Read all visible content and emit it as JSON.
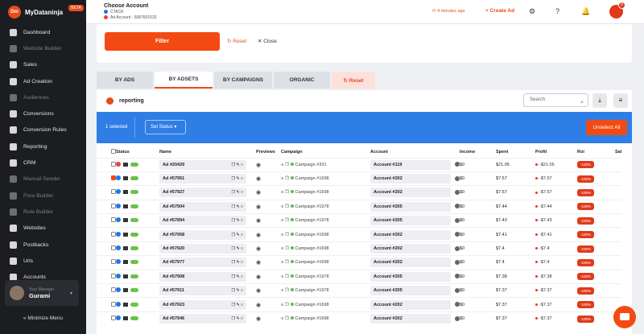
{
  "brand": {
    "logo_text": "Dm",
    "name": "MyDataninja",
    "badge": "BETA"
  },
  "sidebar": {
    "items": [
      {
        "label": "Dashboard",
        "dim": false,
        "icon": "dashboard-icon"
      },
      {
        "label": "Website Builder",
        "dim": true,
        "icon": "website-builder-icon"
      },
      {
        "label": "Sales",
        "dim": false,
        "icon": "sales-icon"
      },
      {
        "label": "Ad Creation",
        "dim": false,
        "icon": "ad-creation-icon"
      },
      {
        "label": "Audiences",
        "dim": true,
        "icon": "audiences-icon"
      },
      {
        "label": "Conversions",
        "dim": false,
        "icon": "conversions-icon"
      },
      {
        "label": "Conversion Rules",
        "dim": false,
        "icon": "conversion-rules-icon"
      },
      {
        "label": "Reporting",
        "dim": false,
        "icon": "reporting-icon"
      },
      {
        "label": "CRM",
        "dim": false,
        "icon": "crm-icon"
      },
      {
        "label": "Manual Sender",
        "dim": true,
        "icon": "manual-sender-icon"
      },
      {
        "label": "Flow Builder",
        "dim": true,
        "icon": "flow-builder-icon"
      },
      {
        "label": "Rule Builder",
        "dim": true,
        "icon": "rule-builder-icon"
      },
      {
        "label": "Websites",
        "dim": false,
        "icon": "websites-icon"
      },
      {
        "label": "Postbacks",
        "dim": false,
        "icon": "postbacks-icon"
      },
      {
        "label": "Urls",
        "dim": false,
        "icon": "urls-icon"
      },
      {
        "label": "Accounts",
        "dim": false,
        "icon": "accounts-icon"
      }
    ],
    "user": {
      "role": "Your Manager",
      "name": "Gurami"
    },
    "minimize_label": "« Minimize Menu"
  },
  "topbar": {
    "account_title": "Choose Account",
    "account_sub1": "CTACK",
    "account_sub2": "Ad Account - 5087601533",
    "updated_ago": "⟳ 4 minutes ago",
    "create_ad": "+ Create Ad",
    "notification_count": "9"
  },
  "filter": {
    "filter_label": "Filter",
    "reset_label": "↻ Reset",
    "close_label": "✕ Close"
  },
  "tabs": [
    "BY ADS",
    "BY ADSETS",
    "BY CAMPAIGNS",
    "ORGANIC",
    "↻ Reset"
  ],
  "reporting": {
    "title": "reporting",
    "search_placeholder": "Search",
    "selected_count": "1 selected",
    "set_status": "Set Status ▾",
    "unselect_all": "Unselect All"
  },
  "table": {
    "headers": [
      "Status",
      "Name",
      "Previews",
      "Campaign",
      "Account",
      "Income",
      "Spent",
      "Profit",
      "Roi",
      "Sal"
    ],
    "rows": [
      {
        "checked": false,
        "platform": "google",
        "name": "Ad #20429",
        "campaign": "Campaign #331",
        "account": "Account #119",
        "income": "$0",
        "spent": "$21.05",
        "profit": "-$21.05",
        "roi": "-100%"
      },
      {
        "checked": true,
        "platform": "facebook",
        "name": "Ad #57951",
        "campaign": "Campaign #1698",
        "account": "Account #202",
        "income": "$0",
        "spent": "$7.57",
        "profit": "-$7.57",
        "roi": "-100%"
      },
      {
        "checked": false,
        "platform": "facebook",
        "name": "Ad #57927",
        "campaign": "Campaign #1698",
        "account": "Account #202",
        "income": "$0",
        "spent": "$7.57",
        "profit": "-$7.57",
        "roi": "-100%"
      },
      {
        "checked": false,
        "platform": "facebook",
        "name": "Ad #57904",
        "campaign": "Campaign #1978",
        "account": "Account #205",
        "income": "$0",
        "spent": "$7.44",
        "profit": "-$7.44",
        "roi": "-100%"
      },
      {
        "checked": false,
        "platform": "facebook",
        "name": "Ad #57894",
        "campaign": "Campaign #1978",
        "account": "Account #205",
        "income": "$0",
        "spent": "$7.43",
        "profit": "-$7.43",
        "roi": "-100%"
      },
      {
        "checked": false,
        "platform": "facebook",
        "name": "Ad #57958",
        "campaign": "Campaign #1698",
        "account": "Account #202",
        "income": "$0",
        "spent": "$7.41",
        "profit": "-$7.41",
        "roi": "-100%"
      },
      {
        "checked": false,
        "platform": "facebook",
        "name": "Ad #57920",
        "campaign": "Campaign #1698",
        "account": "Account #202",
        "income": "$0",
        "spent": "$7.4",
        "profit": "-$7.4",
        "roi": "-100%"
      },
      {
        "checked": false,
        "platform": "facebook",
        "name": "Ad #57977",
        "campaign": "Campaign #1698",
        "account": "Account #202",
        "income": "$0",
        "spent": "$7.4",
        "profit": "-$7.4",
        "roi": "-100%"
      },
      {
        "checked": false,
        "platform": "facebook",
        "name": "Ad #57908",
        "campaign": "Campaign #1978",
        "account": "Account #205",
        "income": "$0",
        "spent": "$7.38",
        "profit": "-$7.38",
        "roi": "-100%"
      },
      {
        "checked": false,
        "platform": "facebook",
        "name": "Ad #57911",
        "campaign": "Campaign #1978",
        "account": "Account #205",
        "income": "$0",
        "spent": "$7.37",
        "profit": "-$7.37",
        "roi": "-100%"
      },
      {
        "checked": false,
        "platform": "facebook",
        "name": "Ad #57923",
        "campaign": "Campaign #1698",
        "account": "Account #202",
        "income": "$0",
        "spent": "$7.37",
        "profit": "-$7.37",
        "roi": "-100%"
      },
      {
        "checked": false,
        "platform": "facebook",
        "name": "Ad #57946",
        "campaign": "Campaign #1698",
        "account": "Account #202",
        "income": "$0",
        "spent": "$7.37",
        "profit": "-$7.37",
        "roi": "-100%"
      }
    ]
  }
}
